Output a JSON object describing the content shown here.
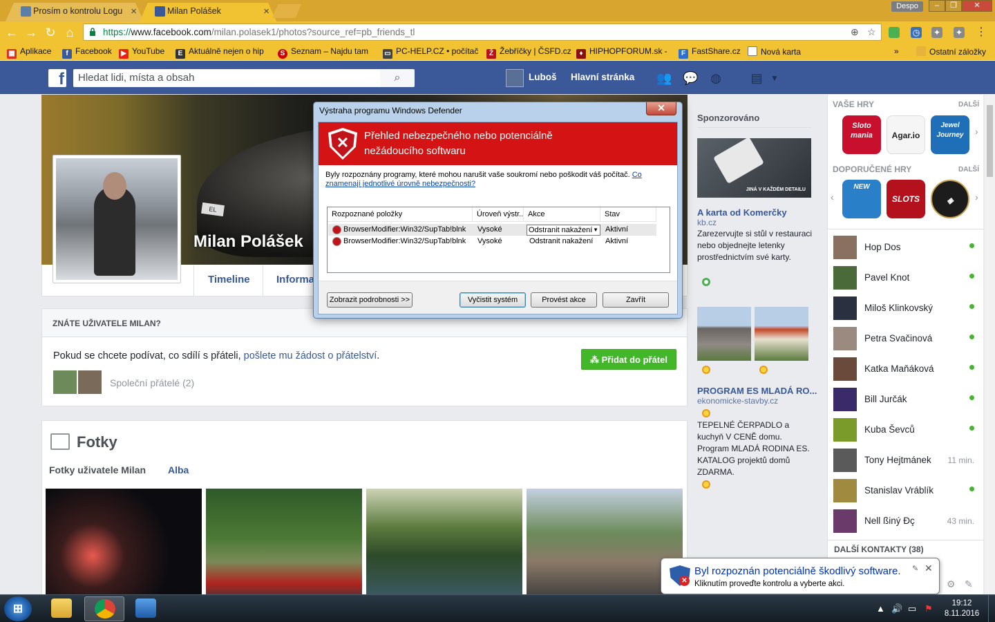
{
  "browser": {
    "tabs": [
      {
        "label": "Prosím o kontrolu Logu"
      },
      {
        "label": "Milan Polášek"
      }
    ],
    "profile_label": "Despo",
    "url_scheme": "https://",
    "url_host": "www.facebook.com",
    "url_path": "/milan.polasek1/photos?source_ref=pb_friends_tl",
    "bookmarks": [
      {
        "label": "Aplikace",
        "icon": "apps-grid-icon",
        "color": "#d93025"
      },
      {
        "label": "Facebook",
        "icon": "facebook-icon",
        "color": "#3b5998"
      },
      {
        "label": "YouTube",
        "icon": "youtube-icon",
        "color": "#e62117"
      },
      {
        "label": "Aktuálně nejen o hip",
        "icon": "page-icon",
        "color": "#333333"
      },
      {
        "label": "Seznam – Najdu tam",
        "icon": "seznam-icon",
        "color": "#cc0000"
      },
      {
        "label": "PC-HELP.CZ • počítač",
        "icon": "monitor-icon",
        "color": "#444444"
      },
      {
        "label": "Žebříčky | ČSFD.cz",
        "icon": "csfd-icon",
        "color": "#b5121b"
      },
      {
        "label": "HIPHOPFORUM.sk - ",
        "icon": "hiphop-icon",
        "color": "#8a1010"
      },
      {
        "label": "FastShare.cz",
        "icon": "fastshare-icon",
        "color": "#2a6fd1"
      },
      {
        "label": "Nová karta",
        "icon": "page-icon",
        "color": "#777777"
      }
    ],
    "bookmarks_overflow": "»",
    "other_bookmarks": "Ostatní záložky"
  },
  "facebook": {
    "search_placeholder": "Hledat lidi, místa a obsah",
    "nav_user": "Luboš",
    "nav_home": "Hlavní stránka",
    "profile_name": "Milan Polášek",
    "cover_plate": "EL 2314",
    "profile_tabs": [
      "Timeline",
      "Informa"
    ],
    "know_card": {
      "heading": "ZNÁTE UŽIVATELE MILAN?",
      "text_prefix": "Pokud se chcete podívat, co sdílí s přáteli, ",
      "text_link": "pošlete mu žádost o přátelství",
      "text_suffix": ".",
      "add_button": "Přidat do přátel",
      "mutual": "Společní přátelé (2)"
    },
    "photos": {
      "title": "Fotky",
      "tabs": [
        "Fotky uživatele Milan",
        "Alba"
      ]
    },
    "sponsored": {
      "title": "Sponzorováno",
      "ad1_image_text": "JINÁ V KAŽDÉM DETAILU",
      "ad1_headline": "A karta od Komerčky",
      "ad1_domain": "kb.cz",
      "ad1_body": "Zarezervujte si stůl v restauraci nebo objednejte letenky prostřednictvím své karty.",
      "ad2_headline": "PROGRAM ES MLADÁ RO...",
      "ad2_domain": "ekonomicke-stavby.cz",
      "ad2_body": "TEPELNÉ ČERPADLO a kuchyň V CENĚ domu. Program MLADÁ RODINA ES. KATALOG projektů domů ZDARMA."
    },
    "sidebar": {
      "games_heading": "VAŠE HRY",
      "more": "DALŠÍ",
      "games": [
        {
          "label": "Sloto mania",
          "color": "#c8102e"
        },
        {
          "label": "Agar.io",
          "color": "#f5f5f5"
        },
        {
          "label": "Jewel Journey",
          "color": "#1f6fb8"
        }
      ],
      "recommended_heading": "DOPORUČENÉ HRY",
      "recommended": [
        {
          "label": "NEW",
          "color": "#2a7fc9"
        },
        {
          "label": "SLOTS",
          "color": "#b3121c"
        },
        {
          "label": "",
          "color": "#1c1c1c"
        }
      ],
      "contacts": [
        {
          "name": "Hop Dos",
          "status": "online"
        },
        {
          "name": "Pavel Knot",
          "status": "online"
        },
        {
          "name": "Miloš Klinkovský",
          "status": "online"
        },
        {
          "name": "Petra Svačinová",
          "status": "online"
        },
        {
          "name": "Katka Maňáková",
          "status": "online"
        },
        {
          "name": "Bill Jurčák",
          "status": "online"
        },
        {
          "name": "Kuba Ševců",
          "status": "online"
        },
        {
          "name": "Tony Hejtmánek",
          "status": "11 min."
        },
        {
          "name": "Stanislav Vráblík",
          "status": "online"
        },
        {
          "name": "Nell ßiný Ðç",
          "status": "43 min."
        }
      ],
      "more_contacts": "DALŠÍ KONTAKTY (38)"
    }
  },
  "defender": {
    "window_title": "Výstraha programu Windows Defender",
    "close_glyph": "✕",
    "heading": "Přehled nebezpečného nebo potenciálně nežádoucího softwaru",
    "description": "Byly rozpoznány programy, které mohou narušit vaše soukromí nebo poškodit váš počítač. ",
    "description_link": "Co znamenají jednotlivé úrovně nebezpečnosti?",
    "columns": [
      "Rozpoznané položky",
      "Úroveň výstr...",
      "Akce",
      "Stav"
    ],
    "rows": [
      {
        "item": "BrowserModifier:Win32/SupTab!blnk",
        "level": "Vysoké",
        "action": "Odstranit nakažení",
        "state": "Aktivní"
      },
      {
        "item": "BrowserModifier:Win32/SupTab!blnk",
        "level": "Vysoké",
        "action": "Odstranit nakažení",
        "state": "Aktivní"
      }
    ],
    "buttons": {
      "details": "Zobrazit podrobnosti >>",
      "clean": "Vyčistit systém",
      "apply": "Provést akce",
      "close": "Zavřít"
    }
  },
  "balloon": {
    "title": "Byl rozpoznán potenciálně škodlivý software.",
    "text": "Kliknutím proveďte kontrolu a vyberte akci.",
    "close_glyph": "✕"
  },
  "taskbar": {
    "time": "19:12",
    "date": "8.11.2016"
  }
}
